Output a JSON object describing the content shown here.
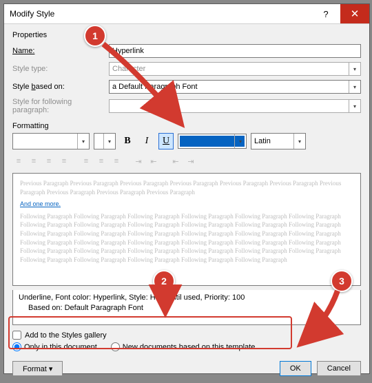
{
  "title": "Modify Style",
  "props_label": "Properties",
  "name_label": "Name:",
  "name_value": "Hyperlink",
  "type_label": "Style type:",
  "type_value": "Character",
  "based_label": "Style based on:",
  "based_value": "a Default Paragraph Font",
  "follow_label": "Style for following paragraph:",
  "follow_value": "",
  "fmt_label": "Formatting",
  "bold": "B",
  "italic": "I",
  "underline": "U",
  "script_value": "Latin",
  "preview_prev": "Previous Paragraph Previous Paragraph Previous Paragraph Previous Paragraph Previous Paragraph Previous Paragraph Previous Paragraph Previous Paragraph Previous Paragraph Previous Paragraph",
  "preview_link": "And one more.",
  "preview_follow": "Following Paragraph Following Paragraph Following Paragraph Following Paragraph Following Paragraph Following Paragraph Following Paragraph Following Paragraph Following Paragraph Following Paragraph Following Paragraph Following Paragraph Following Paragraph Following Paragraph Following Paragraph Following Paragraph Following Paragraph Following Paragraph Following Paragraph Following Paragraph Following Paragraph Following Paragraph Following Paragraph Following Paragraph Following Paragraph Following Paragraph Following Paragraph Following Paragraph Following Paragraph Following Paragraph Following Paragraph Following Paragraph Following Paragraph Following Paragraph Following Paragraph",
  "desc_line1": "Underline, Font color: Hyperlink, Style: Hide until used, Priority: 100",
  "desc_line2": "Based on: Default Paragraph Font",
  "add_gallery": "Add to the Styles gallery",
  "only_doc": "Only in this document",
  "new_docs": "New documents based on this template",
  "format_btn": "Format ▾",
  "ok": "OK",
  "cancel": "Cancel",
  "c1": "1",
  "c2": "2",
  "c3": "3"
}
